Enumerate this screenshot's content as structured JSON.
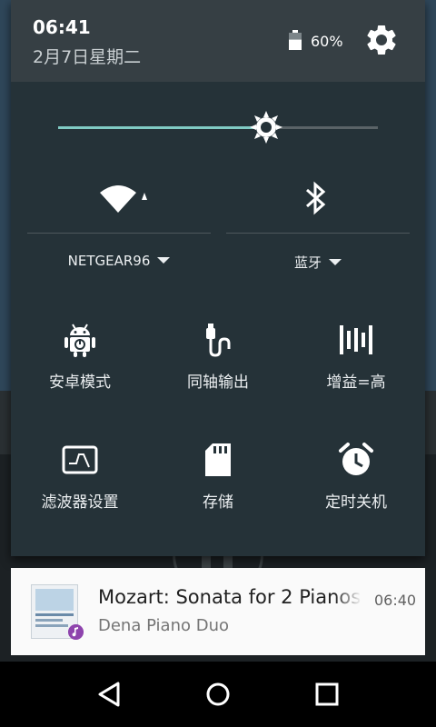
{
  "status": {
    "time": "06:41",
    "date": "2月7日星期二",
    "battery_percent": "60%",
    "battery_level": 0.6
  },
  "brightness": {
    "level": 0.65
  },
  "quick_toggles": {
    "wifi": {
      "label": "NETGEAR96",
      "icon": "wifi-icon"
    },
    "bluetooth": {
      "label": "蓝牙",
      "icon": "bluetooth-icon"
    }
  },
  "tiles": [
    {
      "label": "安卓模式",
      "icon": "android-icon"
    },
    {
      "label": "同轴输出",
      "icon": "coaxial-icon"
    },
    {
      "label": "增益=高",
      "icon": "gain-icon"
    },
    {
      "label": "滤波器设置",
      "icon": "filter-icon"
    },
    {
      "label": "存储",
      "icon": "sd-card-icon"
    },
    {
      "label": "定时关机",
      "icon": "alarm-icon"
    }
  ],
  "media_notification": {
    "title": "Mozart: Sonata for 2 Pianos",
    "artist": "Dena Piano Duo",
    "time": "06:40"
  },
  "colors": {
    "shade_bg": "#253238",
    "header_bg": "#363f44",
    "accent": "#80cbc4"
  }
}
